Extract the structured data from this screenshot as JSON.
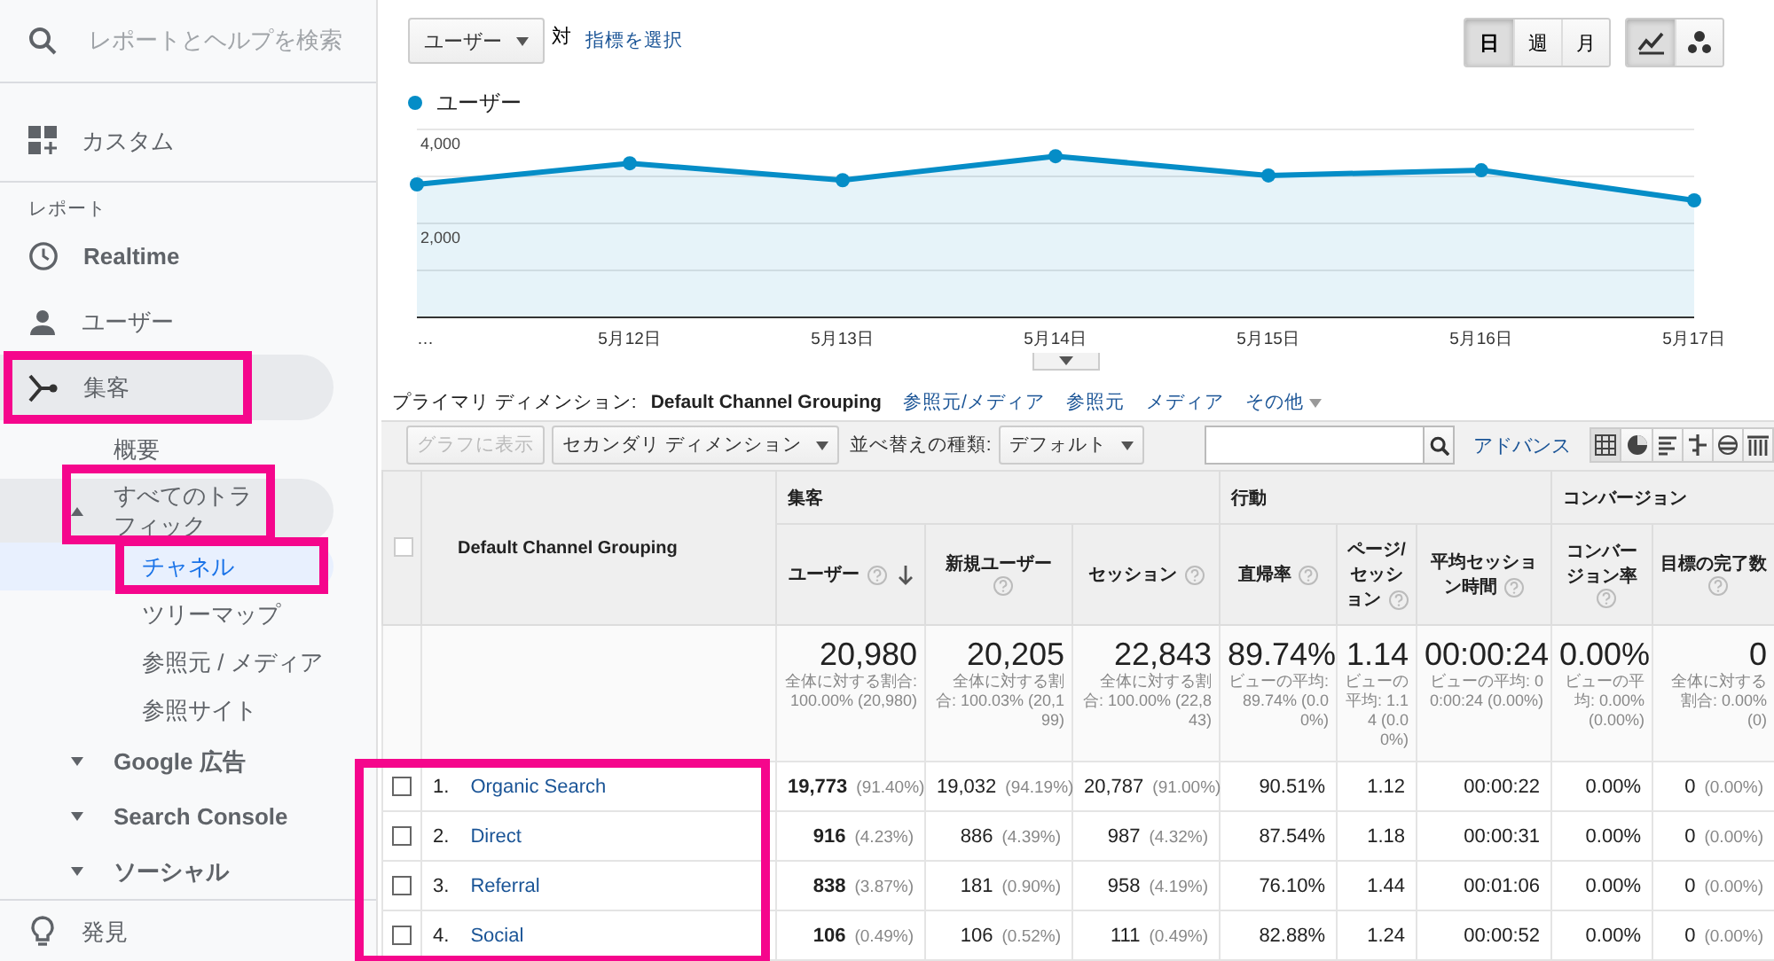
{
  "sidebar": {
    "search": {
      "placeholder": "レポートとヘルプを検索"
    },
    "items": [
      {
        "kind": "custom",
        "label": "カスタム"
      }
    ],
    "section_label": "レポート",
    "reports": [
      {
        "kind": "realtime",
        "label": "Realtime",
        "highlighted": false
      },
      {
        "kind": "user",
        "label": "ユーザー",
        "highlighted": false
      },
      {
        "kind": "acquisition",
        "label": "集客",
        "expanded": true,
        "highlighted": true,
        "children": [
          {
            "label": "概要",
            "highlighted": false
          },
          {
            "label": "すべてのトラフィック",
            "expanded": true,
            "highlighted": true,
            "children": [
              {
                "label": "チャネル",
                "selected": true,
                "highlighted": true
              },
              {
                "label": "ツリーマップ",
                "selected": false,
                "highlighted": false
              },
              {
                "label": "参照元 / メディア",
                "selected": false,
                "highlighted": false
              },
              {
                "label": "参照サイト",
                "selected": false,
                "highlighted": false
              }
            ]
          },
          {
            "label": "Google 広告",
            "expanded": false,
            "highlighted": false
          },
          {
            "label": "Search Console",
            "expanded": false,
            "highlighted": false
          },
          {
            "label": "ソーシャル",
            "expanded": false,
            "highlighted": false
          }
        ]
      }
    ],
    "footer_items": [
      {
        "kind": "discover",
        "label": "発見"
      }
    ]
  },
  "metric_picker": {
    "value": "ユーザー"
  },
  "versus": "対",
  "select_metric": "指標を選択",
  "period_buttons": [
    {
      "label": "日",
      "selected": true
    },
    {
      "label": "週",
      "selected": false
    },
    {
      "label": "月",
      "selected": false
    }
  ],
  "chart_types": [
    {
      "kind": "line",
      "selected": true
    },
    {
      "kind": "motion",
      "selected": false
    }
  ],
  "chart": {
    "chart_data": {
      "type": "area",
      "categories": [
        "…",
        "5月12日",
        "5月13日",
        "5月14日",
        "5月15日",
        "5月16日",
        "5月17日"
      ],
      "series": [
        {
          "name": "ユーザー",
          "color": "#058dc7",
          "values": [
            2830,
            3280,
            2920,
            3430,
            3020,
            3130,
            2490
          ]
        }
      ],
      "ylim": [
        0,
        4000
      ],
      "yticks": [
        {
          "value": 2000,
          "label": "2,000"
        },
        {
          "value": 4000,
          "label": "4,000"
        }
      ]
    }
  },
  "dimension_bar": {
    "label": "プライマリ ディメンション:",
    "options": [
      {
        "label": "Default Channel Grouping",
        "kind": "link",
        "selected": true
      },
      {
        "label": "参照元/メディア",
        "kind": "link",
        "selected": false
      },
      {
        "label": "参照元",
        "kind": "link",
        "selected": false
      },
      {
        "label": "メディア",
        "kind": "link",
        "selected": false
      },
      {
        "label": "その他",
        "kind": "menu",
        "selected": false
      }
    ]
  },
  "toolbar": {
    "chart_button": {
      "label": "グラフに表示",
      "disabled": true
    },
    "secondary_dimension": "セカンダリ ディメンション",
    "sort_label": "並べ替えの種類:",
    "sort_value": "デフォルト",
    "advanced": "アドバンス",
    "views": [
      {
        "kind": "data",
        "selected": true
      },
      {
        "kind": "percentage",
        "selected": false
      },
      {
        "kind": "performance",
        "selected": false
      },
      {
        "kind": "comparison",
        "selected": false
      },
      {
        "kind": "summary",
        "selected": false
      },
      {
        "kind": "pivot",
        "selected": false
      }
    ]
  },
  "table": {
    "header_checked": false,
    "dimension_header": "Default Channel Grouping",
    "rows_highlighted": true,
    "groups": [
      {
        "label": "集客",
        "columns": [
          {
            "label": "ユーザー",
            "sorted": true
          },
          {
            "label": "新規ユーザー",
            "sorted": false
          },
          {
            "label": "セッション",
            "sorted": false
          }
        ]
      },
      {
        "label": "行動",
        "columns": [
          {
            "label": "直帰率",
            "sorted": false
          },
          {
            "label": "ページ/セッション",
            "sorted": false
          },
          {
            "label": "平均セッション時間",
            "sorted": false
          }
        ]
      },
      {
        "label": "コンバージョン",
        "columns": [
          {
            "label": "コンバージョン率",
            "sorted": false
          },
          {
            "label": "目標の完了数",
            "sorted": false
          }
        ]
      }
    ],
    "totals": [
      {
        "value": "20,980",
        "note": "全体に対する割合: 100.00% (20,980)"
      },
      {
        "value": "20,205",
        "note": "全体に対する割合: 100.03% (20,199)"
      },
      {
        "value": "22,843",
        "note": "全体に対する割合: 100.00% (22,843)"
      },
      {
        "value": "89.74%",
        "note": "ビューの平均: 89.74% (0.00%)"
      },
      {
        "value": "1.14",
        "note": "ビューの平均: 1.14 (0.00%)"
      },
      {
        "value": "00:00:24",
        "note": "ビューの平均: 00:00:24 (0.00%)"
      },
      {
        "value": "0.00%",
        "note": "ビューの平均: 0.00% (0.00%)"
      },
      {
        "value": "0",
        "note": "全体に対する割合: 0.00% (0)"
      }
    ],
    "rows": [
      {
        "index": "1.",
        "name": "Organic Search",
        "checked": false,
        "cells": [
          {
            "value": "19,773",
            "share": "(91.40%)"
          },
          {
            "value": "19,032",
            "share": "(94.19%)"
          },
          {
            "value": "20,787",
            "share": "(91.00%)"
          },
          {
            "value": "90.51%"
          },
          {
            "value": "1.12"
          },
          {
            "value": "00:00:22"
          },
          {
            "value": "0.00%"
          },
          {
            "value": "0",
            "share": "(0.00%)"
          }
        ]
      },
      {
        "index": "2.",
        "name": "Direct",
        "checked": false,
        "cells": [
          {
            "value": "916",
            "share": "(4.23%)"
          },
          {
            "value": "886",
            "share": "(4.39%)"
          },
          {
            "value": "987",
            "share": "(4.32%)"
          },
          {
            "value": "87.54%"
          },
          {
            "value": "1.18"
          },
          {
            "value": "00:00:31"
          },
          {
            "value": "0.00%"
          },
          {
            "value": "0",
            "share": "(0.00%)"
          }
        ]
      },
      {
        "index": "3.",
        "name": "Referral",
        "checked": false,
        "cells": [
          {
            "value": "838",
            "share": "(3.87%)"
          },
          {
            "value": "181",
            "share": "(0.90%)"
          },
          {
            "value": "958",
            "share": "(4.19%)"
          },
          {
            "value": "76.10%"
          },
          {
            "value": "1.44"
          },
          {
            "value": "00:01:06"
          },
          {
            "value": "0.00%"
          },
          {
            "value": "0",
            "share": "(0.00%)"
          }
        ]
      },
      {
        "index": "4.",
        "name": "Social",
        "checked": false,
        "cells": [
          {
            "value": "106",
            "share": "(0.49%)"
          },
          {
            "value": "106",
            "share": "(0.52%)"
          },
          {
            "value": "111",
            "share": "(0.49%)"
          },
          {
            "value": "82.88%"
          },
          {
            "value": "1.24"
          },
          {
            "value": "00:00:52"
          },
          {
            "value": "0.00%"
          },
          {
            "value": "0",
            "share": "(0.00%)"
          }
        ]
      }
    ]
  }
}
